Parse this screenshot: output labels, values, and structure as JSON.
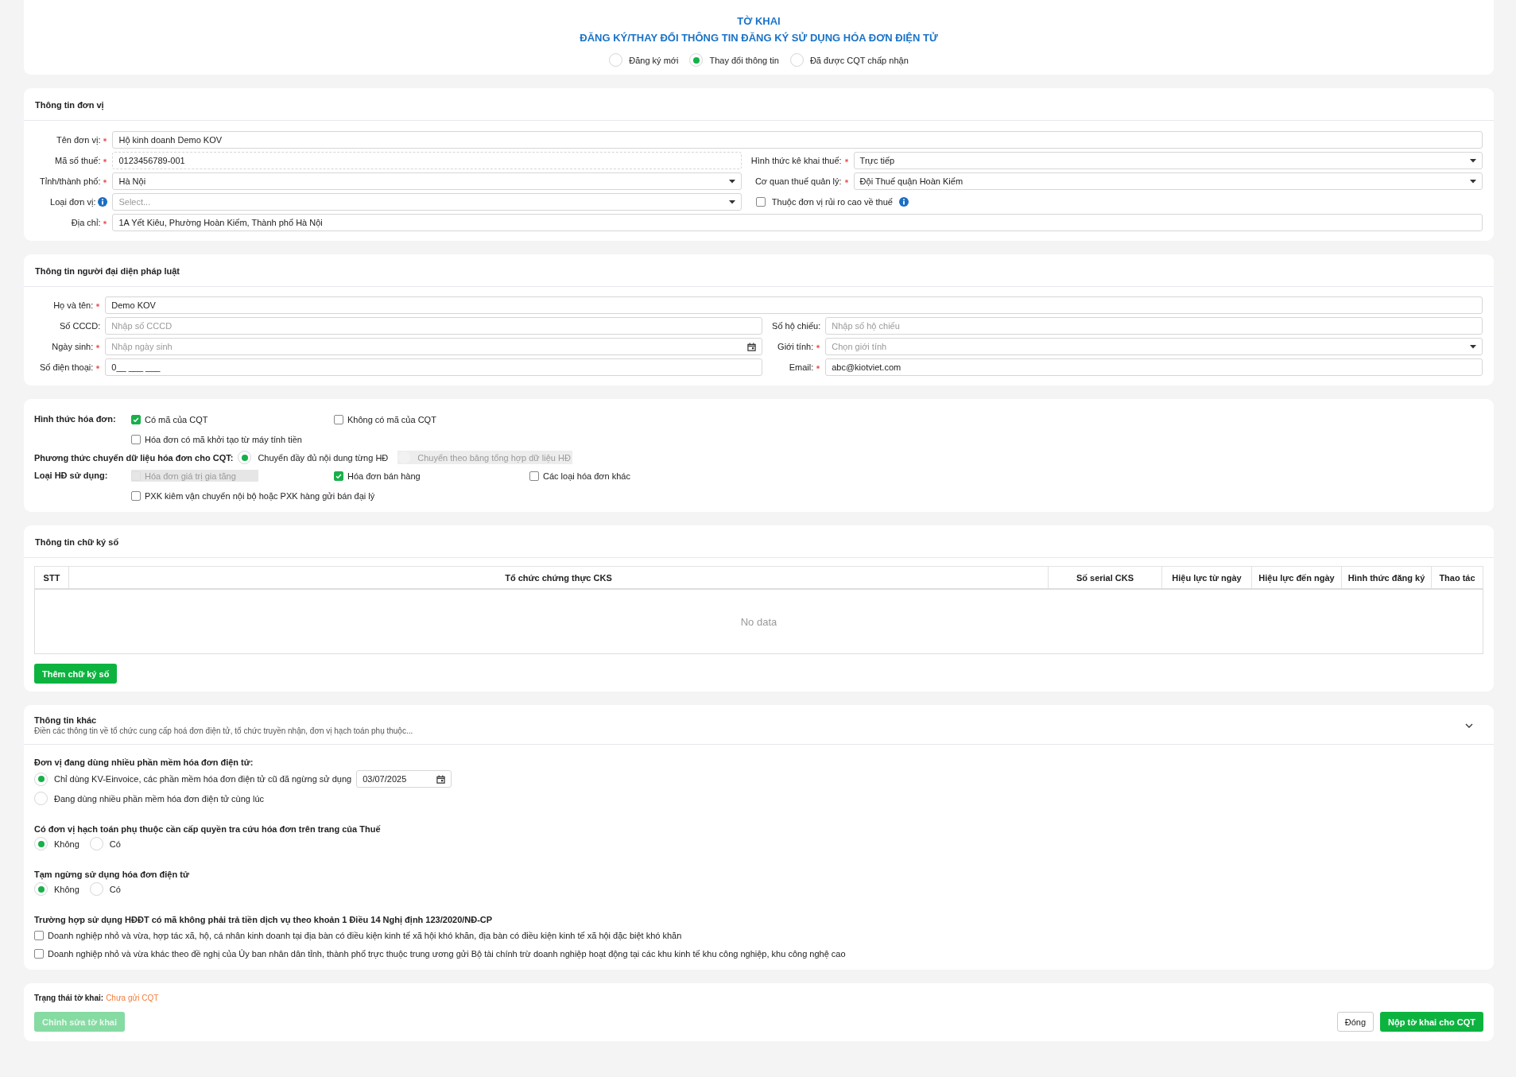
{
  "header": {
    "title": "TỜ KHAI",
    "subtitle": "ĐĂNG KÝ/THAY ĐỔI THÔNG TIN ĐĂNG KÝ SỬ DỤNG HÓA ĐƠN ĐIỆN TỬ",
    "options": [
      {
        "label": "Đăng ký mới",
        "selected": false
      },
      {
        "label": "Thay đổi thông tin",
        "selected": true
      },
      {
        "label": "Đã được CQT chấp nhận",
        "selected": false
      }
    ]
  },
  "unit_info": {
    "title": "Thông tin đơn vị",
    "rows": [
      {
        "fields": [
          {
            "label": "Tên đơn vị:",
            "required": true,
            "kind": "text",
            "value": "Hộ kinh doanh Demo KOV"
          }
        ]
      },
      {
        "fields": [
          {
            "label": "Mã số thuế:",
            "required": true,
            "kind": "readonly",
            "value": "0123456789-001"
          },
          {
            "label": "Hình thức kê khai thuế:",
            "required": true,
            "kind": "select",
            "value": "Trực tiếp"
          }
        ]
      },
      {
        "fields": [
          {
            "label": "Tỉnh/thành phố:",
            "required": true,
            "kind": "select",
            "value": "Hà Nội"
          },
          {
            "label": "Cơ quan thuế quản lý:",
            "required": true,
            "kind": "select",
            "value": "Đội Thuế quận Hoàn Kiếm"
          }
        ]
      },
      {
        "fields": [
          {
            "label": "Loại đơn vị:",
            "required": false,
            "info": true,
            "kind": "select",
            "placeholder": "Select..."
          },
          {
            "label": "Thuộc đơn vị rủi ro cao về thuế",
            "kind": "checkbox",
            "checked": false,
            "info": true
          }
        ]
      },
      {
        "fields": [
          {
            "label": "Địa chỉ:",
            "required": true,
            "kind": "text",
            "value": "1A Yết Kiêu, Phường Hoàn Kiếm, Thành phố Hà Nội"
          }
        ]
      }
    ]
  },
  "representative": {
    "title": "Thông tin người đại diện pháp luật",
    "rows": [
      {
        "fields": [
          {
            "label": "Họ và tên:",
            "required": true,
            "kind": "text",
            "value": "Demo KOV"
          }
        ]
      },
      {
        "fields": [
          {
            "label": "Số CCCD:",
            "required": false,
            "kind": "text",
            "placeholder": "Nhập số CCCD"
          },
          {
            "label": "Số hộ chiếu:",
            "required": false,
            "kind": "text",
            "placeholder": "Nhập số hộ chiếu"
          }
        ]
      },
      {
        "fields": [
          {
            "label": "Ngày sinh:",
            "required": true,
            "kind": "date",
            "placeholder": "Nhập ngày sinh"
          },
          {
            "label": "Giới tính:",
            "required": true,
            "kind": "select",
            "placeholder": "Chọn giới tính"
          }
        ]
      },
      {
        "fields": [
          {
            "label": "Số điện thoại:",
            "required": true,
            "kind": "text",
            "value": "0__ ___ ___"
          },
          {
            "label": "Email:",
            "required": true,
            "kind": "text",
            "value": "abc@kiotviet.com"
          }
        ]
      }
    ]
  },
  "invoice": {
    "rows": [
      {
        "label": "Hình thức hóa đơn:",
        "kind": "checkbox",
        "lines": [
          [
            {
              "label": "Có mã của CQT",
              "checked": true,
              "disabled": false
            },
            {
              "label": "Không có mã của CQT",
              "checked": false,
              "disabled": false
            }
          ],
          [
            {
              "label": "Hóa đơn có mã khởi tạo từ máy tính tiền",
              "checked": false,
              "disabled": false
            }
          ]
        ]
      },
      {
        "label": "Phương thức chuyển dữ liệu hóa đơn cho CQT:",
        "kind": "radio",
        "options": [
          {
            "label": "Chuyển đầy đủ nội dung từng HĐ",
            "selected": true,
            "disabled": false
          },
          {
            "label": "Chuyển theo bảng tổng hợp dữ liệu HĐ",
            "selected": false,
            "disabled": true
          }
        ]
      },
      {
        "label": "Loại HĐ sử dụng:",
        "kind": "checkbox",
        "lines": [
          [
            {
              "label": "Hóa đơn giá trị gia tăng",
              "checked": false,
              "disabled": true
            },
            {
              "label": "Hóa đơn bán hàng",
              "checked": true,
              "disabled": false
            },
            {
              "label": "Các loại hóa đơn khác",
              "checked": false,
              "disabled": false
            }
          ],
          [
            {
              "label": "PXK kiêm vận chuyển nội bộ hoặc PXK hàng gửi bán đại lý",
              "checked": false,
              "disabled": false
            }
          ]
        ]
      }
    ]
  },
  "signatures": {
    "title": "Thông tin chữ ký số",
    "columns": [
      "STT",
      "Tổ chức chứng thực CKS",
      "Số serial CKS",
      "Hiệu lực từ ngày",
      "Hiệu lực đến ngày",
      "Hình thức đăng ký",
      "Thao tác"
    ],
    "empty_text": "No data",
    "add_button": "Thêm chữ ký số"
  },
  "other_info": {
    "title": "Thông tin khác",
    "subtitle": "Điền các thông tin về tổ chức cung cấp hoá đơn điện tử, tổ chức truyền nhận, đơn vị hạch toán phụ thuộc...",
    "expanded": true,
    "groups": [
      {
        "question": "Đơn vị đang dùng nhiều phần mềm hóa đơn điện tử:",
        "kind": "radio_list",
        "options": [
          {
            "label": "Chỉ dùng KV-Einvoice, các phần mềm hóa đơn điện tử cũ đã ngừng sử dụng",
            "selected": true,
            "date": "03/07/2025"
          },
          {
            "label": "Đang dùng nhiều phần mềm hóa đơn điện tử cùng lúc",
            "selected": false
          }
        ]
      },
      {
        "question": "Có đơn vị hạch toán phụ thuộc cần cấp quyền tra cứu hóa đơn trên trang của Thuế",
        "kind": "radio_inline",
        "options": [
          {
            "label": "Không",
            "selected": true
          },
          {
            "label": "Có",
            "selected": false
          }
        ]
      },
      {
        "question": "Tạm ngừng sử dụng hóa đơn điện tử",
        "kind": "radio_inline",
        "options": [
          {
            "label": "Không",
            "selected": true
          },
          {
            "label": "Có",
            "selected": false
          }
        ]
      },
      {
        "question": "Trường hợp sử dụng HĐĐT có mã không phải trả tiền dịch vụ theo khoản 1 Điều 14 Nghị định 123/2020/NĐ-CP",
        "kind": "checkbox_list",
        "options": [
          {
            "label": "Doanh nghiệp nhỏ và vừa, hợp tác xã, hộ, cá nhân kinh doanh tại địa bàn có điều kiện kinh tế xã hội khó khăn, địa bàn có điều kiện kinh tế xã hội đặc biệt khó khăn",
            "checked": false
          },
          {
            "label": "Doanh nghiệp nhỏ và vừa khác theo đề nghị của Ủy ban nhân dân tỉnh, thành phố trực thuộc trung ương gửi Bộ tài chính trừ doanh nghiệp hoạt động tại các khu kinh tế khu công nghiệp, khu công nghệ cao",
            "checked": false
          }
        ]
      }
    ]
  },
  "footer": {
    "status_label": "Trạng thái tờ khai:",
    "status_value": "Chưa gửi CQT",
    "edit_button": {
      "label": "Chỉnh sửa tờ khai",
      "disabled": true
    },
    "close_button": "Đóng",
    "submit_button": "Nộp tờ khai cho CQT"
  }
}
